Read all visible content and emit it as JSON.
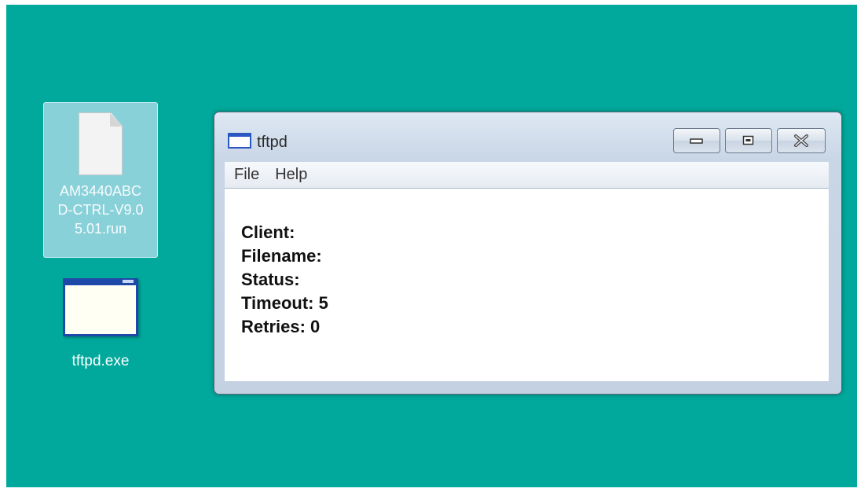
{
  "desktop": {
    "background": "#00a99c",
    "icons": [
      {
        "label": "AM3440ABC\nD-CTRL-V9.0\n5.01.run",
        "icon": "generic-file-icon",
        "selected": true
      },
      {
        "label": "tftpd.exe",
        "icon": "application-window-icon",
        "selected": false
      }
    ]
  },
  "window": {
    "title": "tftpd",
    "title_icon": "application-window-icon",
    "controls": {
      "minimize_icon": "minimize-icon",
      "maximize_icon": "maximize-icon",
      "close_icon": "close-icon"
    },
    "menu": [
      {
        "label": "File"
      },
      {
        "label": "Help"
      }
    ],
    "info": [
      {
        "label": "Client:",
        "value": ""
      },
      {
        "label": "Filename:",
        "value": ""
      },
      {
        "label": "Status:",
        "value": ""
      },
      {
        "label": "Timeout:",
        "value": "5"
      },
      {
        "label": "Retries:",
        "value": "0"
      }
    ]
  }
}
